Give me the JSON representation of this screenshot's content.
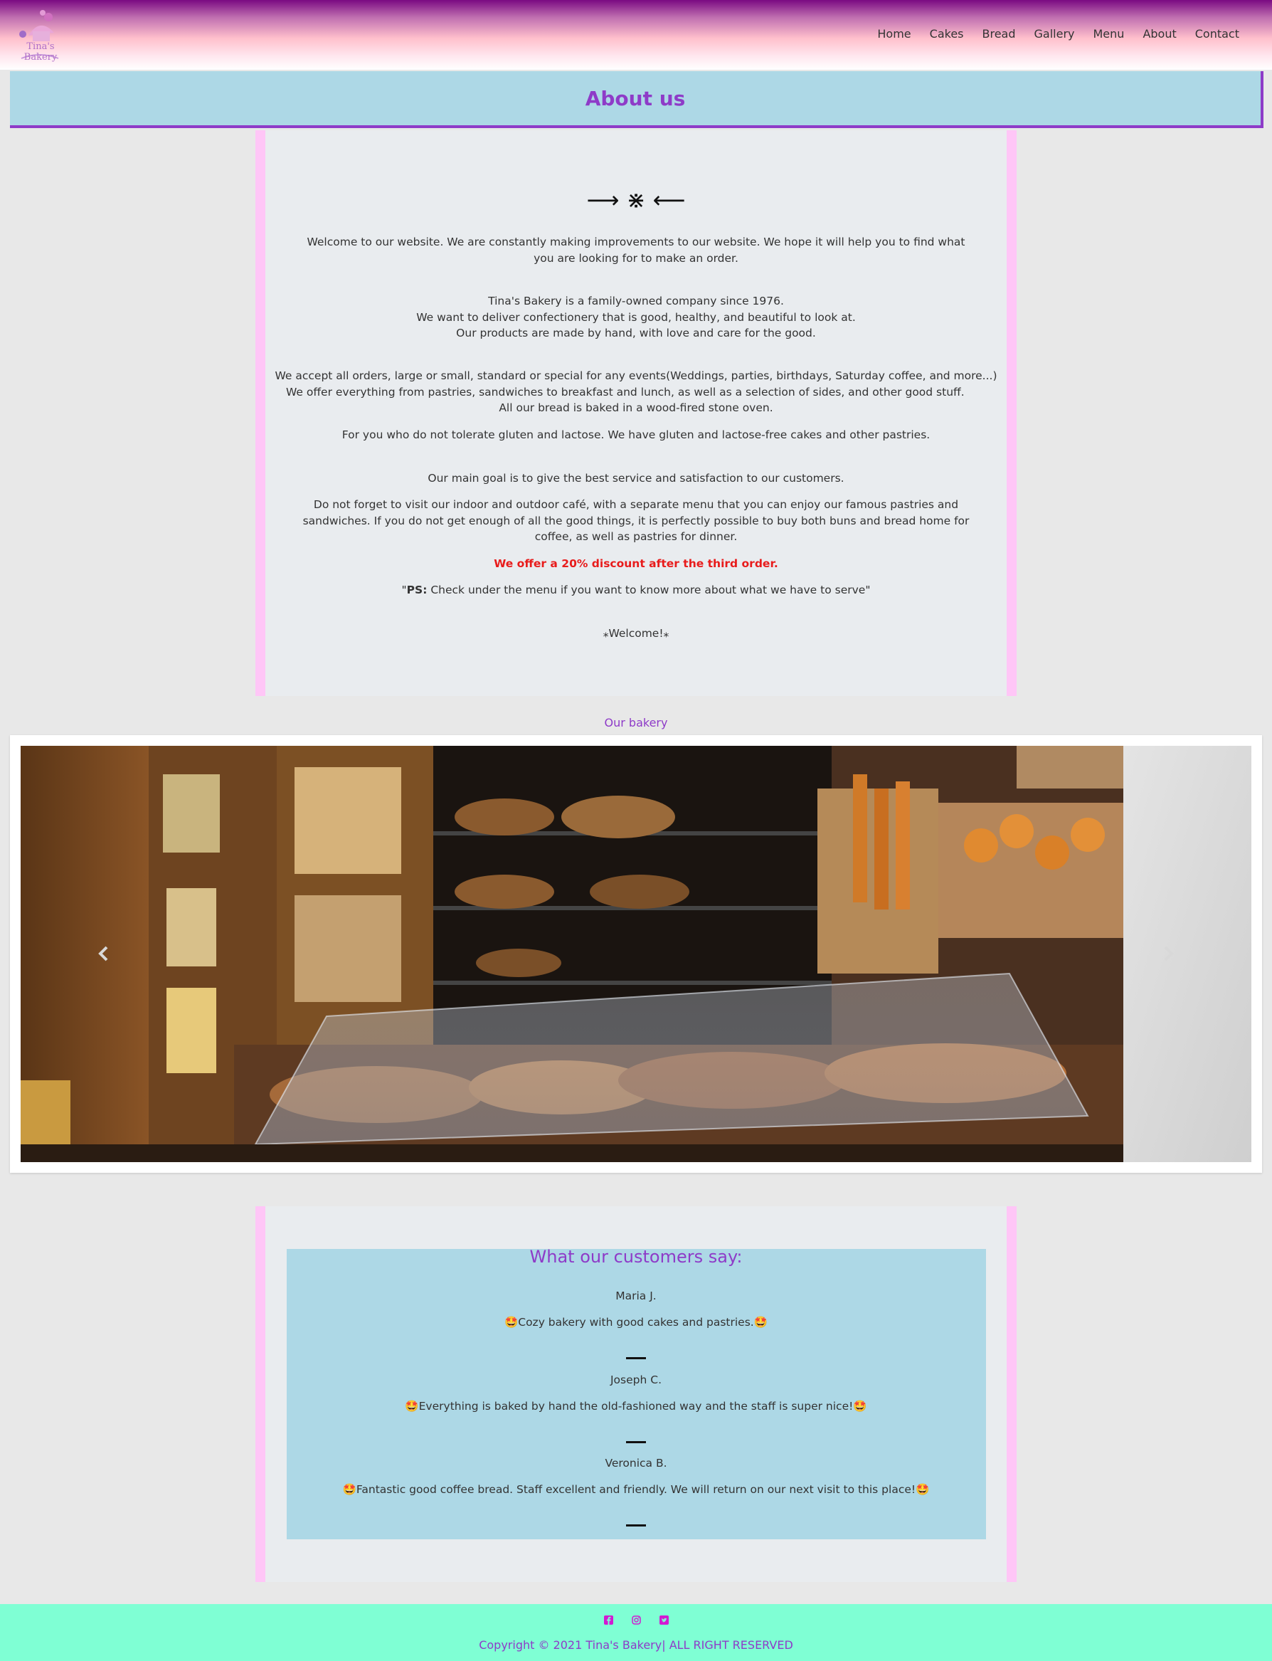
{
  "logo": {
    "text": "Tina's Bakery"
  },
  "nav": {
    "items": [
      "Home",
      "Cakes",
      "Bread",
      "Gallery",
      "Menu",
      "About",
      "Contact"
    ]
  },
  "about": {
    "title": "About us",
    "ornament": "⟶ ⋇ ⟵",
    "p1": "Welcome to our website. We are constantly making improvements to our website. We hope it will help you to find what you are looking for to make an order.",
    "p2_lines": [
      "Tina's Bakery is a family-owned company since 1976.",
      "We want to deliver confectionery that is good, healthy, and beautiful to look at.",
      "Our products are made by hand, with love and care for the good."
    ],
    "p3_lines": [
      "We accept all orders, large or small, standard or special for any events(Weddings, parties, birthdays, Saturday coffee, and more...)",
      "We offer everything from pastries, sandwiches to breakfast and lunch, as well as a selection of sides, and other good stuff.",
      "All our bread is baked in a wood-fired stone oven."
    ],
    "p4": "For you who do not tolerate gluten and lactose. We have gluten and lactose-free cakes and other pastries.",
    "p5": "Our main goal is to give the best service and satisfaction to our customers.",
    "p6": "Do not forget to visit our indoor and outdoor café, with a separate menu that you can enjoy our famous pastries and sandwiches. If you do not get enough of all the good things, it is perfectly possible to buy both buns and bread home for coffee, as well as pastries for dinner.",
    "discount": "We offer a 20% discount after the third order.",
    "ps_label": "PS:",
    "ps_text": " Check under the menu if you want to know more about what we have to serve\"",
    "ps_open": "\"",
    "welcome": "⁎Welcome!⁎"
  },
  "gallery": {
    "label": "Our bakery",
    "prev_icon": "chevron-left-icon",
    "next_icon": "chevron-right-icon"
  },
  "reviews": {
    "title": "What our customers say:",
    "items": [
      {
        "name": "Maria J.",
        "text": "🤩Cozy bakery with good cakes and pastries.🤩"
      },
      {
        "name": "Joseph C.",
        "text": "🤩Everything is baked by hand the old-fashioned way and the staff is super nice!🤩"
      },
      {
        "name": "Veronica B.",
        "text": "🤩Fantastic good coffee bread. Staff excellent and friendly. We will return on our next visit to this place!🤩"
      }
    ]
  },
  "footer": {
    "social": [
      "facebook-icon",
      "instagram-icon",
      "twitter-icon"
    ],
    "copyright": "Copyright © 2021 Tina's Bakery| ALL RIGHT RESERVED"
  },
  "colors": {
    "accent": "#8e3bc8",
    "banner": "#add8e6",
    "panel_border": "#ffc6f7",
    "footer": "#7fffd4",
    "discount": "#e81c1c"
  }
}
